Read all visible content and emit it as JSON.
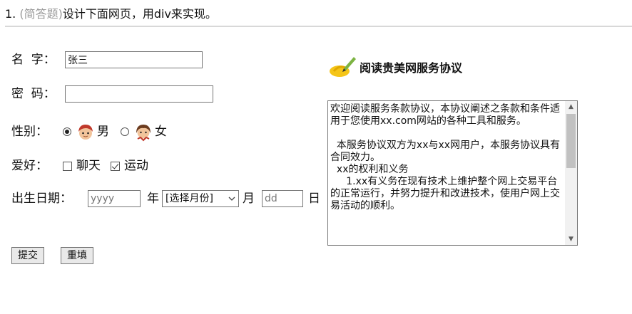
{
  "header": {
    "number": "1.",
    "tag": "(简答题)",
    "question": "设计下面网页，用div来实现。"
  },
  "form": {
    "name_label": "名  字：",
    "name_value": "张三",
    "password_label": "密  码：",
    "password_value": "",
    "gender_label": "性别：",
    "gender_options": [
      {
        "label": "男",
        "checked": true,
        "icon": "boy-avatar-icon"
      },
      {
        "label": "女",
        "checked": false,
        "icon": "girl-avatar-icon"
      }
    ],
    "hobby_label": "爱好：",
    "hobbies": [
      {
        "label": "聊天",
        "checked": false
      },
      {
        "label": "运动",
        "checked": true
      }
    ],
    "birth_label": "出生日期：",
    "year_placeholder": "yyyy",
    "year_unit": "年",
    "month_selected": "[选择月份]",
    "month_unit": "月",
    "day_placeholder": "dd",
    "day_unit": "日",
    "submit_label": "提交",
    "reset_label": "重填"
  },
  "agreement": {
    "title": "阅读贵美网服务协议",
    "text": "欢迎阅读服务条款协议，本协议阐述之条款和条件适用于您使用xx.com网站的各种工具和服务。\n\n  本服务协议双方为xx与xx网用户，本服务协议具有合同效力。\n  xx的权利和义务\n     1.xx有义务在现有技术上维护整个网上交易平台的正常运行，并努力提升和改进技术，使用户网上交易活动的顺利。"
  }
}
